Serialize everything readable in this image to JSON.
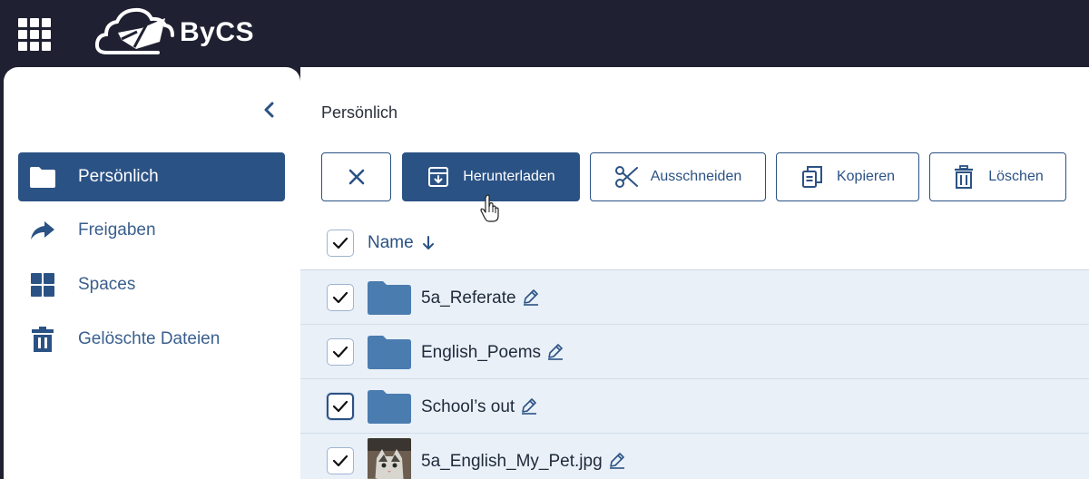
{
  "app": {
    "logo_text": "ByCS"
  },
  "sidebar": {
    "items": [
      {
        "label": "Persönlich",
        "icon": "folder-icon",
        "active": true
      },
      {
        "label": "Freigaben",
        "icon": "share-arrow-icon",
        "active": false
      },
      {
        "label": "Spaces",
        "icon": "grid-icon",
        "active": false
      },
      {
        "label": "Gelöschte Dateien",
        "icon": "trash-icon",
        "active": false
      }
    ]
  },
  "main": {
    "breadcrumb": "Persönlich",
    "toolbar": {
      "clear_icon": "close-icon",
      "download_label": "Herunterladen",
      "cut_label": "Ausschneiden",
      "copy_label": "Kopieren",
      "delete_label": "Löschen"
    },
    "list": {
      "header": {
        "name_label": "Name",
        "sort_icon": "arrow-down-icon",
        "all_selected": true
      },
      "rows": [
        {
          "name": "5a_Referate",
          "type": "folder",
          "selected": true
        },
        {
          "name": "English_Poems",
          "type": "folder",
          "selected": true
        },
        {
          "name": "School’s out",
          "type": "folder",
          "selected": true
        },
        {
          "name": "5a_English_My_Pet.jpg",
          "type": "image",
          "selected": true
        }
      ]
    }
  },
  "colors": {
    "topbar": "#1f2132",
    "accent": "#2b5284",
    "row_selected": "#e9f0f8",
    "folder": "#4a7cb0"
  }
}
